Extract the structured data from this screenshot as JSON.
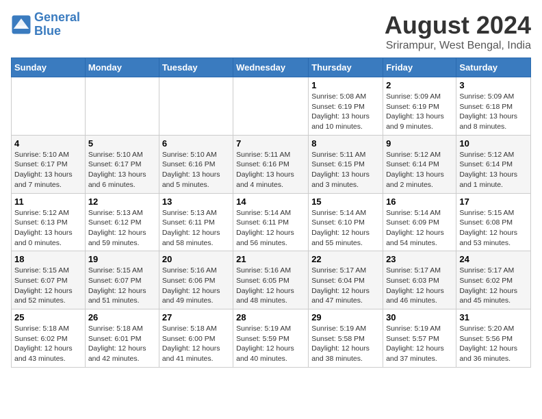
{
  "header": {
    "logo_line1": "General",
    "logo_line2": "Blue",
    "month_year": "August 2024",
    "location": "Srirampur, West Bengal, India"
  },
  "weekdays": [
    "Sunday",
    "Monday",
    "Tuesday",
    "Wednesday",
    "Thursday",
    "Friday",
    "Saturday"
  ],
  "weeks": [
    [
      {
        "day": "",
        "info": ""
      },
      {
        "day": "",
        "info": ""
      },
      {
        "day": "",
        "info": ""
      },
      {
        "day": "",
        "info": ""
      },
      {
        "day": "1",
        "info": "Sunrise: 5:08 AM\nSunset: 6:19 PM\nDaylight: 13 hours\nand 10 minutes."
      },
      {
        "day": "2",
        "info": "Sunrise: 5:09 AM\nSunset: 6:19 PM\nDaylight: 13 hours\nand 9 minutes."
      },
      {
        "day": "3",
        "info": "Sunrise: 5:09 AM\nSunset: 6:18 PM\nDaylight: 13 hours\nand 8 minutes."
      }
    ],
    [
      {
        "day": "4",
        "info": "Sunrise: 5:10 AM\nSunset: 6:17 PM\nDaylight: 13 hours\nand 7 minutes."
      },
      {
        "day": "5",
        "info": "Sunrise: 5:10 AM\nSunset: 6:17 PM\nDaylight: 13 hours\nand 6 minutes."
      },
      {
        "day": "6",
        "info": "Sunrise: 5:10 AM\nSunset: 6:16 PM\nDaylight: 13 hours\nand 5 minutes."
      },
      {
        "day": "7",
        "info": "Sunrise: 5:11 AM\nSunset: 6:16 PM\nDaylight: 13 hours\nand 4 minutes."
      },
      {
        "day": "8",
        "info": "Sunrise: 5:11 AM\nSunset: 6:15 PM\nDaylight: 13 hours\nand 3 minutes."
      },
      {
        "day": "9",
        "info": "Sunrise: 5:12 AM\nSunset: 6:14 PM\nDaylight: 13 hours\nand 2 minutes."
      },
      {
        "day": "10",
        "info": "Sunrise: 5:12 AM\nSunset: 6:14 PM\nDaylight: 13 hours\nand 1 minute."
      }
    ],
    [
      {
        "day": "11",
        "info": "Sunrise: 5:12 AM\nSunset: 6:13 PM\nDaylight: 13 hours\nand 0 minutes."
      },
      {
        "day": "12",
        "info": "Sunrise: 5:13 AM\nSunset: 6:12 PM\nDaylight: 12 hours\nand 59 minutes."
      },
      {
        "day": "13",
        "info": "Sunrise: 5:13 AM\nSunset: 6:11 PM\nDaylight: 12 hours\nand 58 minutes."
      },
      {
        "day": "14",
        "info": "Sunrise: 5:14 AM\nSunset: 6:11 PM\nDaylight: 12 hours\nand 56 minutes."
      },
      {
        "day": "15",
        "info": "Sunrise: 5:14 AM\nSunset: 6:10 PM\nDaylight: 12 hours\nand 55 minutes."
      },
      {
        "day": "16",
        "info": "Sunrise: 5:14 AM\nSunset: 6:09 PM\nDaylight: 12 hours\nand 54 minutes."
      },
      {
        "day": "17",
        "info": "Sunrise: 5:15 AM\nSunset: 6:08 PM\nDaylight: 12 hours\nand 53 minutes."
      }
    ],
    [
      {
        "day": "18",
        "info": "Sunrise: 5:15 AM\nSunset: 6:07 PM\nDaylight: 12 hours\nand 52 minutes."
      },
      {
        "day": "19",
        "info": "Sunrise: 5:15 AM\nSunset: 6:07 PM\nDaylight: 12 hours\nand 51 minutes."
      },
      {
        "day": "20",
        "info": "Sunrise: 5:16 AM\nSunset: 6:06 PM\nDaylight: 12 hours\nand 49 minutes."
      },
      {
        "day": "21",
        "info": "Sunrise: 5:16 AM\nSunset: 6:05 PM\nDaylight: 12 hours\nand 48 minutes."
      },
      {
        "day": "22",
        "info": "Sunrise: 5:17 AM\nSunset: 6:04 PM\nDaylight: 12 hours\nand 47 minutes."
      },
      {
        "day": "23",
        "info": "Sunrise: 5:17 AM\nSunset: 6:03 PM\nDaylight: 12 hours\nand 46 minutes."
      },
      {
        "day": "24",
        "info": "Sunrise: 5:17 AM\nSunset: 6:02 PM\nDaylight: 12 hours\nand 45 minutes."
      }
    ],
    [
      {
        "day": "25",
        "info": "Sunrise: 5:18 AM\nSunset: 6:02 PM\nDaylight: 12 hours\nand 43 minutes."
      },
      {
        "day": "26",
        "info": "Sunrise: 5:18 AM\nSunset: 6:01 PM\nDaylight: 12 hours\nand 42 minutes."
      },
      {
        "day": "27",
        "info": "Sunrise: 5:18 AM\nSunset: 6:00 PM\nDaylight: 12 hours\nand 41 minutes."
      },
      {
        "day": "28",
        "info": "Sunrise: 5:19 AM\nSunset: 5:59 PM\nDaylight: 12 hours\nand 40 minutes."
      },
      {
        "day": "29",
        "info": "Sunrise: 5:19 AM\nSunset: 5:58 PM\nDaylight: 12 hours\nand 38 minutes."
      },
      {
        "day": "30",
        "info": "Sunrise: 5:19 AM\nSunset: 5:57 PM\nDaylight: 12 hours\nand 37 minutes."
      },
      {
        "day": "31",
        "info": "Sunrise: 5:20 AM\nSunset: 5:56 PM\nDaylight: 12 hours\nand 36 minutes."
      }
    ]
  ]
}
